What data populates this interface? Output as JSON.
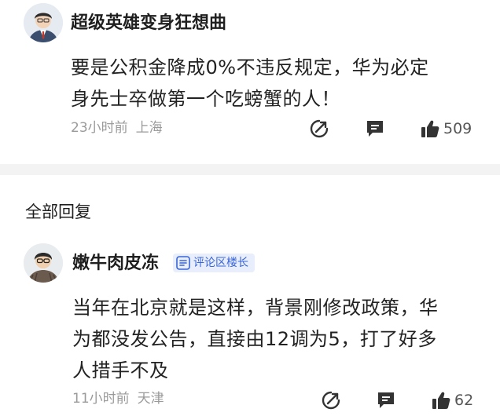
{
  "comment": {
    "author": "超级英雄变身狂想曲",
    "lines": [
      "要是公积金降成0%不违反规定，华为必定",
      "身先士卒做第一个吃螃蟹的人！"
    ],
    "time": "23小时前",
    "location": "上海",
    "likes": "509"
  },
  "replies_section": {
    "title": "全部回复"
  },
  "reply": {
    "author": "嫩牛肉皮冻",
    "badge": "评论区楼长",
    "lines": [
      "当年在北京就是这样，背景刚修改政策，华",
      "为都没发公告，直接由12调为5，打了好多",
      "人措手不及"
    ],
    "time": "11小时前",
    "location": "天津",
    "likes": "62"
  },
  "icons": {
    "share": "share-icon",
    "comment": "comment-icon",
    "like": "thumbs-up-icon"
  }
}
